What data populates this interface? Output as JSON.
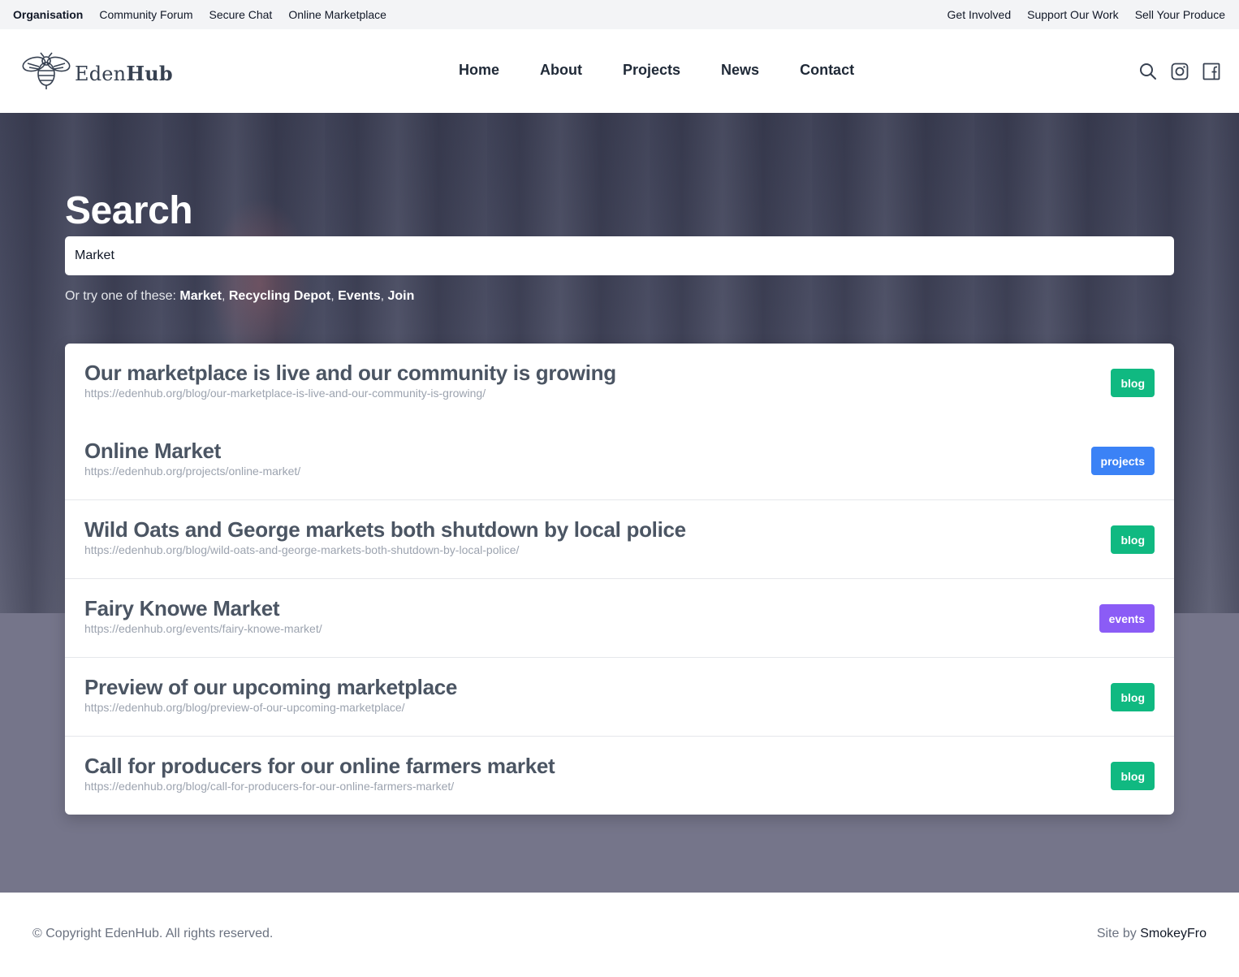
{
  "topbar": {
    "left": [
      {
        "label": "Organisation",
        "active": true
      },
      {
        "label": "Community Forum",
        "active": false
      },
      {
        "label": "Secure Chat",
        "active": false
      },
      {
        "label": "Online Marketplace",
        "active": false
      }
    ],
    "right": [
      {
        "label": "Get Involved"
      },
      {
        "label": "Support Our Work"
      },
      {
        "label": "Sell Your Produce"
      }
    ]
  },
  "brand": {
    "name_light": "Eden",
    "name_bold": "Hub",
    "logo_icon": "bee-icon"
  },
  "nav": {
    "items": [
      {
        "label": "Home"
      },
      {
        "label": "About"
      },
      {
        "label": "Projects"
      },
      {
        "label": "News"
      },
      {
        "label": "Contact"
      }
    ],
    "icons": [
      "search-icon",
      "instagram-icon",
      "facebook-icon"
    ]
  },
  "search": {
    "title": "Search",
    "value": "Market",
    "suggest_prefix": "Or try one of these:",
    "suggestions": [
      "Market",
      "Recycling Depot",
      "Events",
      "Join"
    ]
  },
  "results": [
    {
      "title": "Our marketplace is live and our community is growing",
      "url": "https://edenhub.org/blog/our-marketplace-is-live-and-our-community-is-growing/",
      "tag": "blog"
    },
    {
      "title": "Online Market",
      "url": "https://edenhub.org/projects/online-market/",
      "tag": "projects"
    },
    {
      "title": "Wild Oats and George markets both shutdown by local police",
      "url": "https://edenhub.org/blog/wild-oats-and-george-markets-both-shutdown-by-local-police/",
      "tag": "blog"
    },
    {
      "title": "Fairy Knowe Market",
      "url": "https://edenhub.org/events/fairy-knowe-market/",
      "tag": "events"
    },
    {
      "title": "Preview of our upcoming marketplace",
      "url": "https://edenhub.org/blog/preview-of-our-upcoming-marketplace/",
      "tag": "blog"
    },
    {
      "title": "Call for producers for our online farmers market",
      "url": "https://edenhub.org/blog/call-for-producers-for-our-online-farmers-market/",
      "tag": "blog"
    }
  ],
  "tag_colors": {
    "blog": "#10b981",
    "projects": "#3b82f6",
    "events": "#8b5cf6"
  },
  "footer": {
    "copyright": "© Copyright EdenHub. All rights reserved.",
    "credit_prefix": "Site by",
    "credit_name": "SmokeyFro"
  }
}
